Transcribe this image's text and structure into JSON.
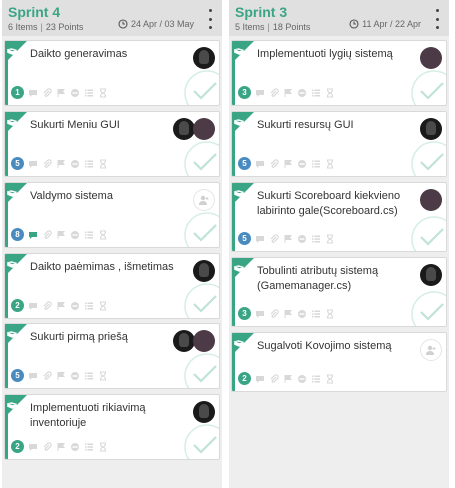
{
  "columns": [
    {
      "title": "Sprint 4",
      "items": "6 Items",
      "points": "23 Points",
      "dates": "24 Apr / 03 May",
      "cards": [
        {
          "title": "Daikto generavimas",
          "points": "1",
          "points_color": "green",
          "avatars": [
            "dark"
          ],
          "has_comment": false
        },
        {
          "title": "Sukurti Meniu GUI",
          "points": "5",
          "points_color": "blue",
          "avatars": [
            "dark",
            "plain"
          ],
          "has_comment": false
        },
        {
          "title": "Valdymo sistema",
          "points": "8",
          "points_color": "blue",
          "avatars": [
            "empty"
          ],
          "has_comment": true
        },
        {
          "title": "Daikto paėmimas , išmetimas",
          "points": "2",
          "points_color": "green",
          "avatars": [
            "dark"
          ],
          "has_comment": false
        },
        {
          "title": "Sukurti pirmą priešą",
          "points": "5",
          "points_color": "blue",
          "avatars": [
            "dark",
            "plain"
          ],
          "has_comment": false
        },
        {
          "title": "Implementuoti rikiavimą inventoriuje",
          "points": "2",
          "points_color": "green",
          "avatars": [
            "dark"
          ],
          "has_comment": false
        }
      ]
    },
    {
      "title": "Sprint 3",
      "items": "5 Items",
      "points": "18 Points",
      "dates": "11 Apr / 22 Apr",
      "cards": [
        {
          "title": "Implementuoti lygių sistemą",
          "points": "3",
          "points_color": "green",
          "avatars": [
            "plain"
          ],
          "has_comment": false
        },
        {
          "title": "Sukurti resursų GUI",
          "points": "5",
          "points_color": "blue",
          "avatars": [
            "dark"
          ],
          "has_comment": false
        },
        {
          "title": "Sukurti Scoreboard kiekvieno labirinto gale(Scoreboard.cs)",
          "points": "5",
          "points_color": "blue",
          "avatars": [
            "plain"
          ],
          "has_comment": false
        },
        {
          "title": "Tobulinti atributų sistemą (Gamemanager.cs)",
          "points": "3",
          "points_color": "green",
          "avatars": [
            "dark"
          ],
          "has_comment": false
        },
        {
          "title": "Sugalvoti Kovojimo sistemą",
          "points": "2",
          "points_color": "green",
          "avatars": [
            "empty"
          ],
          "has_comment": false
        }
      ]
    }
  ],
  "colors": {
    "accent": "#3aa584",
    "points_blue": "#4a8bbf",
    "points_green": "#3aa584"
  },
  "icons": [
    "book-icon",
    "comment-icon",
    "attachment-icon",
    "flag-icon",
    "blocked-icon",
    "list-icon",
    "hourglass-icon",
    "checkmark-icon",
    "clock-icon",
    "more-vertical-icon",
    "add-user-icon"
  ]
}
